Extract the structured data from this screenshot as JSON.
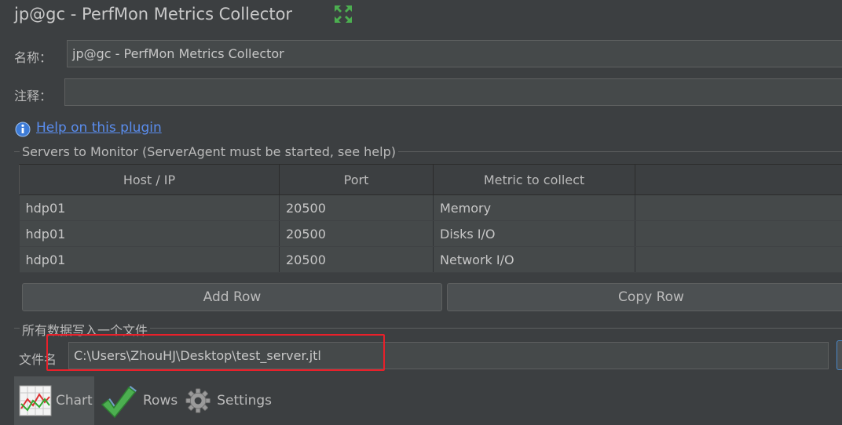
{
  "header": {
    "title": "jp@gc - PerfMon Metrics Collector",
    "icon": "expand-icon"
  },
  "name_field": {
    "label": "名称：",
    "value": "jp@gc - PerfMon Metrics Collector"
  },
  "comment_field": {
    "label": "注释：",
    "value": ""
  },
  "help": {
    "link_text": "Help on this plugin"
  },
  "servers_section": {
    "legend": "Servers to Monitor (ServerAgent must be started, see help)",
    "columns": [
      "Host / IP",
      "Port",
      "Metric to collect",
      ""
    ],
    "rows": [
      [
        "hdp01",
        "20500",
        "Memory",
        ""
      ],
      [
        "hdp01",
        "20500",
        "Disks I/O",
        ""
      ],
      [
        "hdp01",
        "20500",
        "Network I/O",
        ""
      ]
    ],
    "add_row_label": "Add Row",
    "copy_row_label": "Copy Row"
  },
  "file_section": {
    "legend": "所有数据写入一个文件",
    "filename_label": "文件名",
    "filename_value": "C:\\Users\\ZhouHJ\\Desktop\\test_server.jtl"
  },
  "tabs": [
    {
      "label": "Chart",
      "icon": "chart-icon",
      "selected": true
    },
    {
      "label": "Rows",
      "icon": "checkmark-icon",
      "selected": false
    },
    {
      "label": "Settings",
      "icon": "gear-icon",
      "selected": false
    }
  ],
  "colors": {
    "background": "#3c3f41",
    "link": "#5a8dee",
    "highlight_box": "#e8202a"
  }
}
